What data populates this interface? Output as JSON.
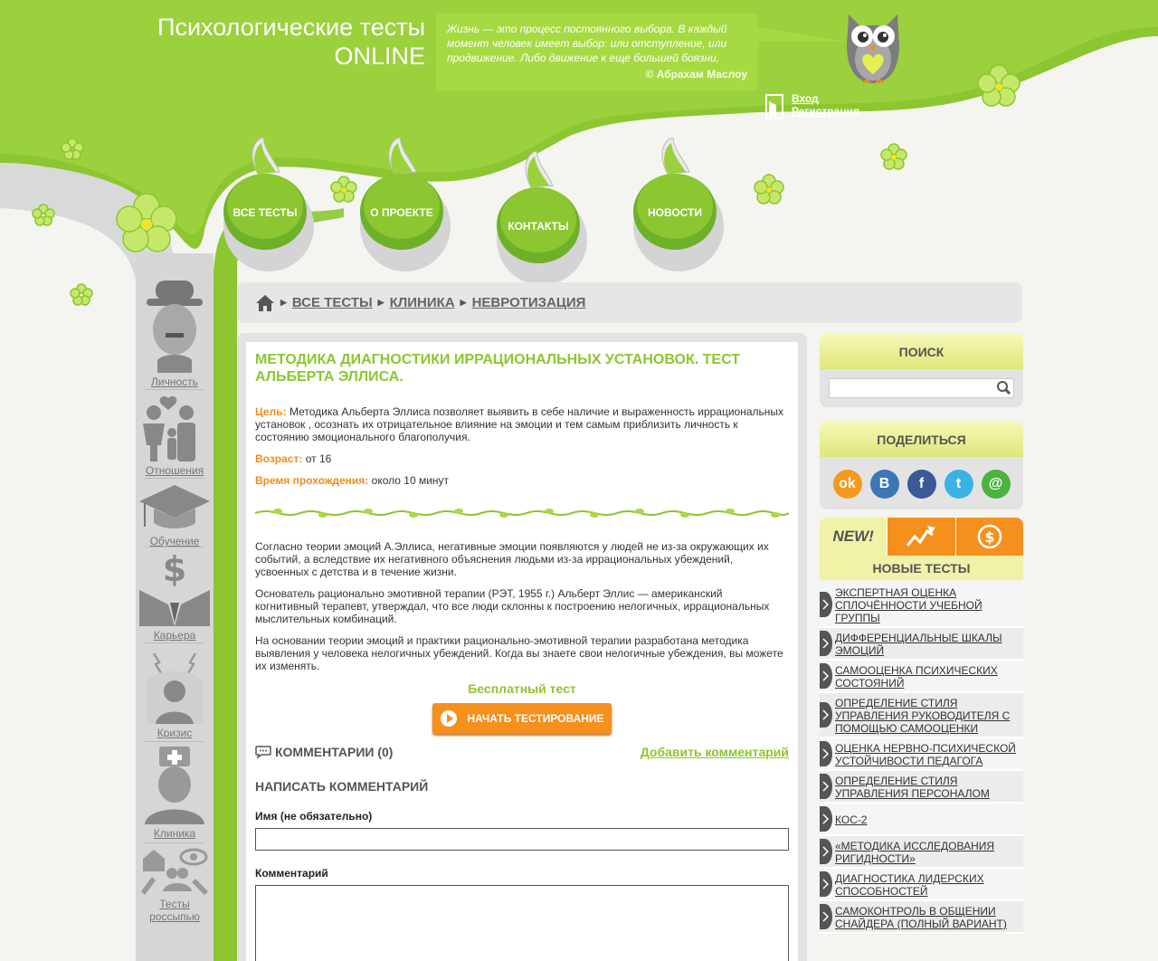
{
  "header": {
    "site_title_line1": "Психологические тесты",
    "site_title_line2": "ONLINE",
    "quote_text": "Жизнь — это процесс постоянного выбора. В каждый момент человек имеет выбор: или отступление, или продвижение. Либо движение к еще большей боязни,",
    "quote_author": "© Абрахам Маслоу",
    "login_label": "Вход",
    "register_label": "Регистрация"
  },
  "nav": {
    "all_tests": "ВСЕ ТЕСТЫ",
    "about": "О ПРОЕКТЕ",
    "contacts": "КОНТАКТЫ",
    "news": "НОВОСТИ"
  },
  "sidebar": {
    "items": [
      {
        "label": "Личность",
        "icon": "charlie-chaplin-icon"
      },
      {
        "label": "Отношения",
        "icon": "family-icon"
      },
      {
        "label": "Обучение",
        "icon": "graduation-cap-icon"
      },
      {
        "label": "Карьера",
        "icon": "businessman-icon"
      },
      {
        "label": "Кризис",
        "icon": "stressed-person-icon"
      },
      {
        "label": "Клиника",
        "icon": "nurse-icon"
      },
      {
        "label": "Тесты россыпью",
        "icon": "mixed-tests-icon"
      }
    ]
  },
  "breadcrumb": {
    "home_icon": "home-icon",
    "items": [
      "ВСЕ ТЕСТЫ",
      "КЛИНИКА",
      "НЕВРОТИЗАЦИЯ"
    ]
  },
  "article": {
    "title": "МЕТОДИКА ДИАГНОСТИКИ ИРРАЦИОНАЛЬНЫХ УСТАНОВОК. ТЕСТ АЛЬБЕРТА ЭЛЛИСА.",
    "goal_label": "Цель:",
    "goal_text": "Методика Альберта Эллиса позволяет выявить в себе наличие и выраженность иррациональных установок , осознать их отрицательное влияние на эмоции и тем самым приблизить личность к состоянию эмоционального благополучия.",
    "age_label": "Возраст:",
    "age_text": "от 16",
    "time_label": "Время прохождения:",
    "time_text": "около 10 минут",
    "paragraph1": "Согласно теории эмоций А.Эллиса, негативные эмоции появляются у людей не из-за окружающих их событий, а вследствие их негативного объяснения людьми из-за иррациональных убеждений, усвоенных с детства и в течение жизни.",
    "paragraph2": "Основатель рационально эмотивной терапии (РЭТ, 1955 г.) Альберт Эллис — американский когнитивный терапевт, утверждал, что все люди склонны к построению нелогичных, иррациональных мыслительных комбинаций.",
    "paragraph3": "На основании теории эмоций и практики рационально-эмотивной терапии разработана методика выявления у человека нелогичных убеждений. Когда вы знаете свои нелогичные убеждения, вы можете их изменять.",
    "free_label": "Бесплатный тест",
    "start_button": "НАЧАТЬ ТЕСТИРОВАНИЕ"
  },
  "comments": {
    "heading": "КОММЕНТАРИИ (0)",
    "add_link": "Добавить комментарий",
    "write_heading": "НАПИСАТЬ КОММЕНТАРИЙ",
    "name_label": "Имя (не обязательно)",
    "name_value": "",
    "comment_label": "Комментарий",
    "comment_value": ""
  },
  "search": {
    "heading": "ПОИСК",
    "value": ""
  },
  "share": {
    "heading": "ПОДЕЛИТЬСЯ",
    "networks": [
      {
        "icon": "odnoklassniki-icon",
        "color": "#f59a1e",
        "glyph": "ok"
      },
      {
        "icon": "vkontakte-icon",
        "color": "#3e76b6",
        "glyph": "В"
      },
      {
        "icon": "facebook-icon",
        "color": "#3b5998",
        "glyph": "f"
      },
      {
        "icon": "twitter-icon",
        "color": "#3ab2e6",
        "glyph": "t"
      },
      {
        "icon": "mail-icon",
        "color": "#4bb33e",
        "glyph": "@"
      }
    ]
  },
  "new_tests": {
    "tab_new": "NEW!",
    "heading": "НОВЫЕ ТЕСТЫ",
    "items": [
      "ЭКСПЕРТНАЯ ОЦЕНКА СПЛОЧЁННОСТИ УЧЕБНОЙ ГРУППЫ",
      "ДИФФЕРЕНЦИАЛЬНЫЕ ШКАЛЫ ЭМОЦИЙ",
      "САМООЦЕНКА ПСИХИЧЕСКИХ СОСТОЯНИЙ",
      "ОПРЕДЕЛЕНИЕ СТИЛЯ УПРАВЛЕНИЯ РУКОВОДИТЕЛЯ С ПОМОЩЬЮ САМООЦЕНКИ",
      "ОЦЕНКА НЕРВНО-ПСИХИЧЕСКОЙ УСТОЙЧИВОСТИ ПЕДАГОГА",
      "ОПРЕДЕЛЕНИЕ СТИЛЯ УПРАВЛЕНИЯ ПЕРСОНАЛОМ",
      "КОС-2",
      "«МЕТОДИКА ИССЛЕДОВАНИЯ РИГИДНОСТИ»",
      "ДИАГНОСТИКА ЛИДЕРСКИХ СПОСОБНОСТЕЙ",
      "САМОКОНТРОЛЬ В ОБЩЕНИИ СНАЙДЕРА (ПОЛНЫЙ ВАРИАНТ)"
    ]
  },
  "colors": {
    "brand_green": "#8cc630",
    "accent_orange": "#f5901e"
  }
}
